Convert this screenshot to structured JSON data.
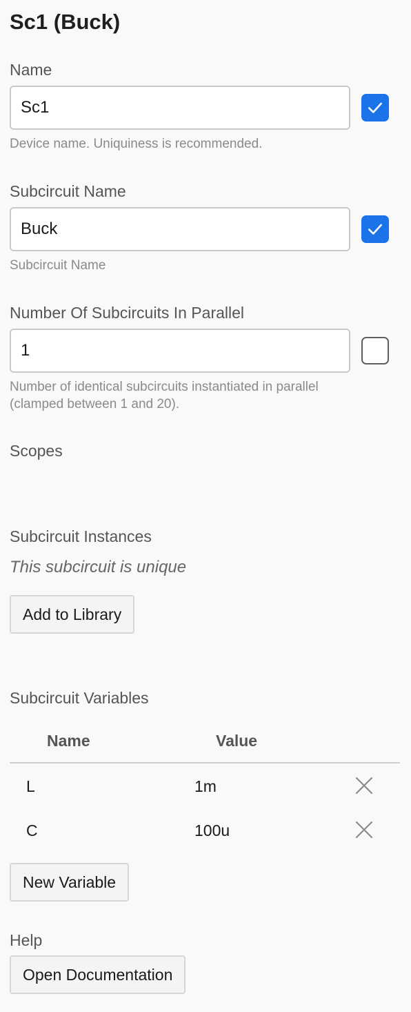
{
  "header": {
    "title": "Sc1 (Buck)"
  },
  "name_field": {
    "label": "Name",
    "value": "Sc1",
    "checked": true,
    "hint": "Device name. Uniquiness is recommended."
  },
  "subcircuit_name_field": {
    "label": "Subcircuit Name",
    "value": "Buck",
    "checked": true,
    "hint": "Subcircuit Name"
  },
  "parallel_field": {
    "label": "Number Of Subcircuits In Parallel",
    "value": "1",
    "checked": false,
    "hint_line1": "Number of identical subcircuits instantiated in parallel",
    "hint_line2": "(clamped between 1 and 20)."
  },
  "scopes": {
    "label": "Scopes"
  },
  "instances": {
    "label": "Subcircuit Instances",
    "status": "This subcircuit is unique",
    "add_button": "Add to Library"
  },
  "variables": {
    "label": "Subcircuit Variables",
    "columns": [
      "Name",
      "Value"
    ],
    "rows": [
      {
        "name": "L",
        "value": "1m"
      },
      {
        "name": "C",
        "value": "100u"
      }
    ],
    "new_button": "New Variable"
  },
  "help": {
    "label": "Help",
    "doc_button": "Open Documentation"
  },
  "colors": {
    "accent": "#1a73e8",
    "background": "#f9f9f9",
    "delete_icon": "#8c8c8c"
  },
  "icons": {
    "checked": "checkmark-icon",
    "delete": "close-x-icon"
  }
}
